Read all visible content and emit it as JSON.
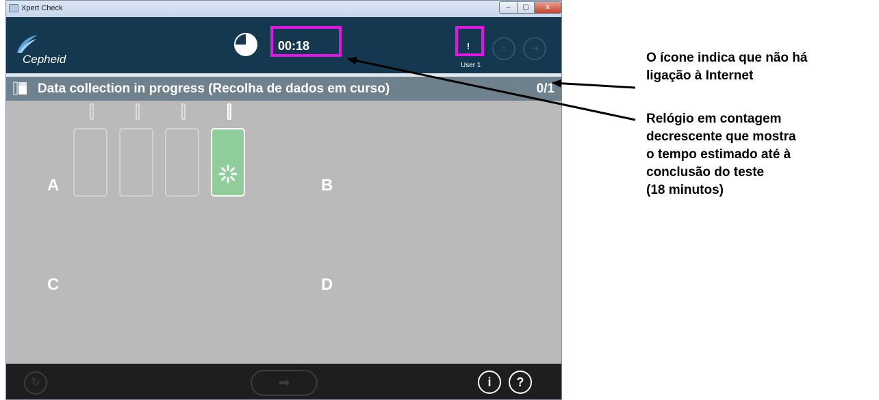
{
  "window": {
    "title": "Xpert Check",
    "controls": {
      "minimize": "–",
      "maximize": "▢",
      "close": "x"
    }
  },
  "header": {
    "logo_text": "Cepheid",
    "timer": "00:18",
    "progress_fraction": 0.75,
    "network_icon_glyph": "!",
    "user": "User 1",
    "home_icon": "home-icon",
    "logout_icon": "logout-icon"
  },
  "status_bar": {
    "text": "Data collection in progress (Recolha de dados em curso)",
    "count": "0/1"
  },
  "modules": {
    "a": "A",
    "b": "B",
    "c": "C",
    "d": "D",
    "active_slot": 4,
    "slot_count": 4
  },
  "footer": {
    "info_label": "i",
    "help_label": "?",
    "refresh_icon": "refresh-icon",
    "next_icon": "arrow-right-icon"
  },
  "annotations": {
    "internet_line1": "O ícone indica que não há",
    "internet_line2": "ligação à Internet",
    "clock_line1": "Relógio em contagem",
    "clock_line2": "decrescente que mostra",
    "clock_line3": "o tempo estimado até à",
    "clock_line4": "conclusão do teste",
    "clock_line5": "(18 minutos)"
  },
  "colors": {
    "header_bg": "#143850",
    "status_bg": "#6e818d",
    "main_bg": "#bababa",
    "highlight": "#e414e6",
    "active_slot": "#8fcd9b"
  }
}
